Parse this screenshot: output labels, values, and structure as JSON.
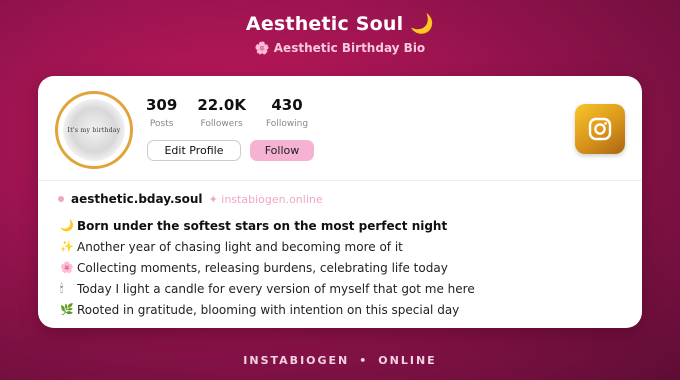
{
  "header": {
    "title": "Aesthetic Soul",
    "title_emoji": "🌙",
    "subtitle_emoji": "🌸",
    "subtitle": "Aesthetic Birthday Bio"
  },
  "profile": {
    "avatar_text": "It's my birthday",
    "stats": [
      {
        "value": "309",
        "label": "Posts"
      },
      {
        "value": "22.0K",
        "label": "Followers"
      },
      {
        "value": "430",
        "label": "Following"
      }
    ],
    "edit_label": "Edit Profile",
    "follow_label": "Follow",
    "handle": "aesthetic.bday.soul",
    "site": "✦ instabiogen.online"
  },
  "bio": [
    {
      "emoji": "🌙",
      "text": "Born under the softest stars on the most perfect night",
      "bold": true
    },
    {
      "emoji": "✨",
      "text": "Another year of chasing light and becoming more of it",
      "bold": false
    },
    {
      "emoji": "🌸",
      "text": "Collecting moments, releasing burdens, celebrating life today",
      "bold": false
    },
    {
      "emoji": "🕯",
      "text": "Today I light a candle for every version of myself that got me here",
      "bold": false
    },
    {
      "emoji": "🌿",
      "text": "Rooted in gratitude, blooming with intention on this special day",
      "bold": false
    }
  ],
  "footer": {
    "left": "INSTABIOGEN",
    "sep": "•",
    "right": "ONLINE"
  },
  "colors": {
    "background": "#9c1450",
    "accent_pink": "#f5b2d2",
    "avatar_ring": "#e0a43a",
    "instagram_gold": "#d9941a"
  },
  "icons": {
    "brand": "instagram-icon"
  }
}
